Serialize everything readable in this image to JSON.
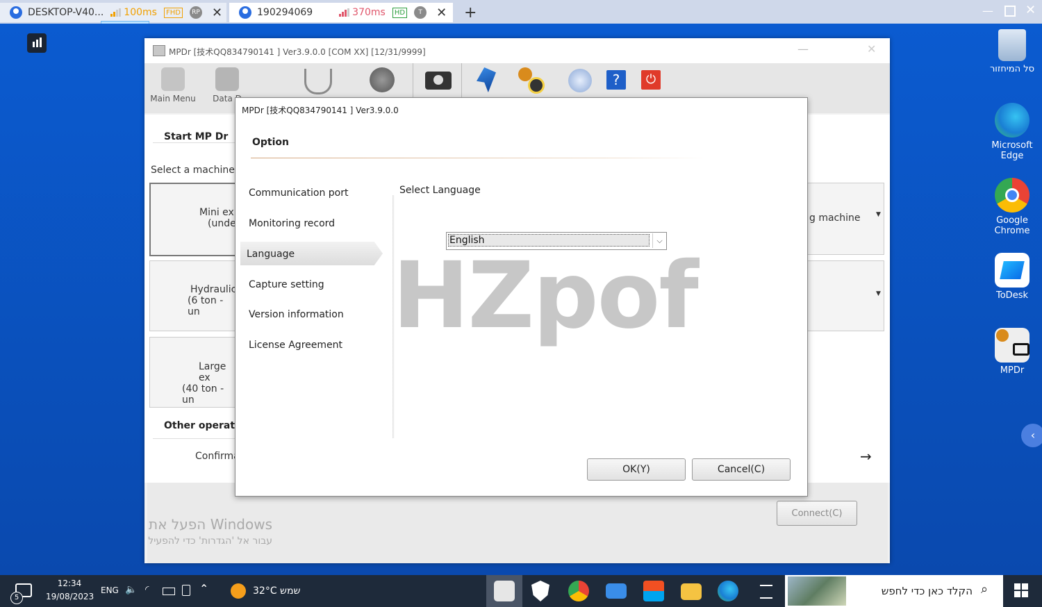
{
  "remote_tabs": [
    {
      "name": "DESKTOP-V40...",
      "latency": "100ms",
      "quality": "FHD",
      "badge": "RP"
    },
    {
      "name": "190294069",
      "latency": "370ms",
      "quality": "HD",
      "badge": "T"
    }
  ],
  "app": {
    "title": "MPDr [技术QQ834790141 ] Ver3.9.0.0 [COM XX] [12/31/9999]",
    "toolbar": [
      "Main Menu",
      "Data D"
    ],
    "start_heading": "Start MP Dr",
    "select_machine": "Select a machine ty",
    "machines": [
      {
        "line1": "Mini ex",
        "line2": "(under"
      },
      {
        "line1": "Hydraulic",
        "line2": "(6 ton - un"
      },
      {
        "line1": "Large ex",
        "line2": "(40 ton - un"
      }
    ],
    "right_machine_label": "g machine",
    "other_heading": "Other operatio",
    "confirm_label": "Confirma",
    "connect_label": "Connect(C)",
    "windows_activation_1": "הפעל את Windows",
    "windows_activation_2": "עבור אל 'הגדרות' כדי להפעיל"
  },
  "dialog": {
    "title": "MPDr [技术QQ834790141 ] Ver3.9.0.0",
    "heading": "Option",
    "nav": [
      "Communication port",
      "Monitoring record",
      "Language",
      "Capture setting",
      "Version information",
      "License Agreement"
    ],
    "selected_nav": "Language",
    "select_language_label": "Select Language",
    "language_value": "English",
    "watermark": "HZpof",
    "ok_label": "OK(Y)",
    "cancel_label": "Cancel(C)"
  },
  "desktop_icons": [
    {
      "label": "סל המיחזור"
    },
    {
      "label": "Microsoft Edge"
    },
    {
      "label": "Google Chrome"
    },
    {
      "label": "ToDesk"
    },
    {
      "label": "MPDr"
    }
  ],
  "taskbar": {
    "time": "12:34",
    "date": "19/08/2023",
    "lang": "ENG",
    "weather": "32°C שמש",
    "search_placeholder": "הקלד כאן כדי לחפש",
    "notif_count": "5"
  }
}
